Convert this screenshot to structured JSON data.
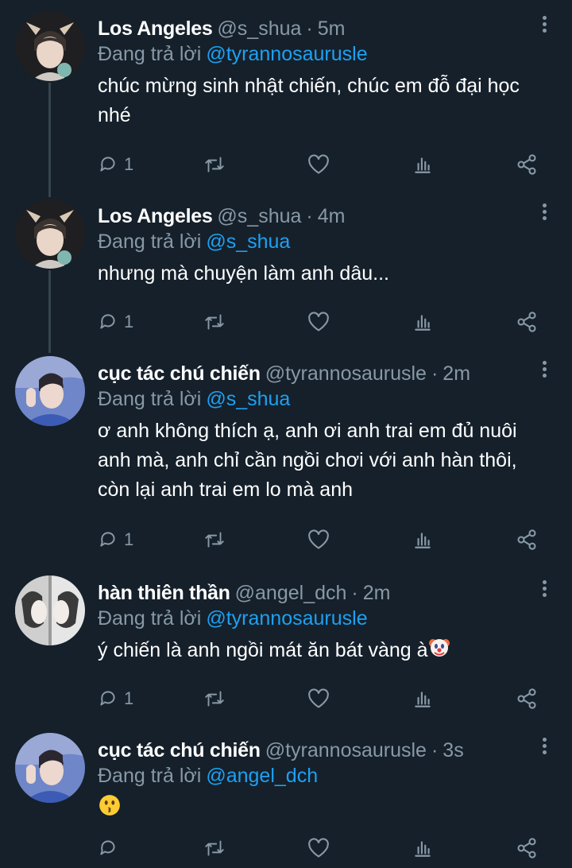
{
  "tweets": [
    {
      "name": "Los Angeles",
      "handle": "@s_shua",
      "time": "5m",
      "reply_prefix": "Đang trả lời",
      "reply_to": "@tyrannosaurusle",
      "text": "chúc mừng sinh nhật chiến, chúc em đỗ đại học nhé",
      "reply_count": "1",
      "avatar": "deer-ears-boy"
    },
    {
      "name": "Los Angeles",
      "handle": "@s_shua",
      "time": "4m",
      "reply_prefix": "Đang trả lời",
      "reply_to": "@s_shua",
      "text": "nhưng mà chuyện làm anh dâu...",
      "reply_count": "1",
      "avatar": "deer-ears-boy"
    },
    {
      "name": "cục tác chú chiến",
      "handle": "@tyrannosaurusle",
      "time": "2m",
      "reply_prefix": "Đang trả lời",
      "reply_to": "@s_shua",
      "text": "ơ anh không thích ạ, anh ơi anh trai em đủ nuôi anh mà, anh chỉ cần ngồi chơi với anh hàn thôi, còn lại anh trai em lo mà anh",
      "reply_count": "1",
      "avatar": "blue-shirt-boy"
    },
    {
      "name": "hàn thiên thần",
      "handle": "@angel_dch",
      "time": "2m",
      "reply_prefix": "Đang trả lời",
      "reply_to": "@tyrannosaurusle",
      "text": "ý chiến là anh ngồi mát ăn bát vàng à",
      "emoji": "clown-face-emoji",
      "reply_count": "1",
      "avatar": "mirror-portrait"
    },
    {
      "name": "cục tác chú chiến",
      "handle": "@tyrannosaurusle",
      "time": "3s",
      "reply_prefix": "Đang trả lời",
      "reply_to": "@angel_dch",
      "text": "",
      "emoji": "kissing-face-emoji",
      "reply_count": "",
      "avatar": "blue-shirt-boy"
    }
  ],
  "icons": {
    "reply": "reply-icon",
    "retweet": "retweet-icon",
    "like": "heart-icon",
    "analytics": "analytics-icon",
    "share": "share-icon",
    "more": "more-icon"
  },
  "colors": {
    "background": "#15202b",
    "link": "#1da1f2",
    "muted": "#8899a6",
    "thread_line": "#38444d"
  }
}
